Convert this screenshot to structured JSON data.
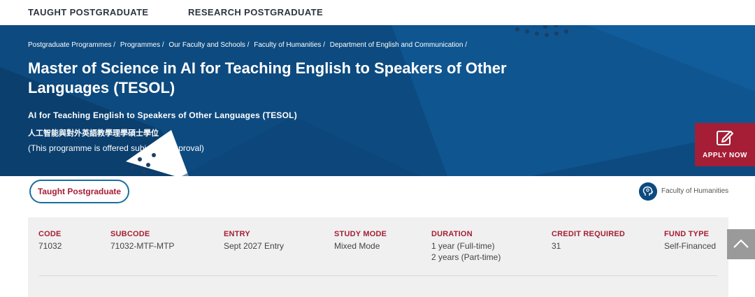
{
  "nav": {
    "taught": "TAUGHT POSTGRADUATE",
    "research": "RESEARCH POSTGRADUATE"
  },
  "breadcrumb": [
    "Postgraduate Programmes /",
    "Programmes /",
    "Our Faculty and Schools /",
    "Faculty of Humanities /",
    "Department of English and Communication /"
  ],
  "hero": {
    "title": "Master of Science in AI for Teaching English to Speakers of Other Languages (TESOL)",
    "subtitle": "AI for Teaching English to Speakers of Other Languages (TESOL)",
    "chinese_title": "人工智能與對外英語教學理學碩士學位",
    "approval_note": "(This programme is offered subject to approval)"
  },
  "apply": {
    "label": "APPLY NOW",
    "icon": "edit-icon"
  },
  "category_pill": "Taught Postgraduate",
  "faculty": {
    "label": "Faculty of Humanities",
    "icon": "head-icon"
  },
  "info": {
    "code": {
      "label": "CODE",
      "value": "71032"
    },
    "subcode": {
      "label": "SUBCODE",
      "value": "71032-MTF-MTP"
    },
    "entry": {
      "label": "ENTRY",
      "value": "Sept 2027 Entry"
    },
    "study_mode": {
      "label": "STUDY MODE",
      "value": "Mixed Mode"
    },
    "duration": {
      "label": "DURATION",
      "value_1": "1 year (Full-time)",
      "value_2": "2 years (Part-time)"
    },
    "credit": {
      "label": "CREDIT REQUIRED",
      "value": "31"
    },
    "fund": {
      "label": "FUND TYPE",
      "value": "Self-Financed"
    }
  },
  "colors": {
    "hero_blue": "#0d4a7f",
    "accent_red": "#a51e36",
    "pill_border": "#1a6ea0"
  }
}
